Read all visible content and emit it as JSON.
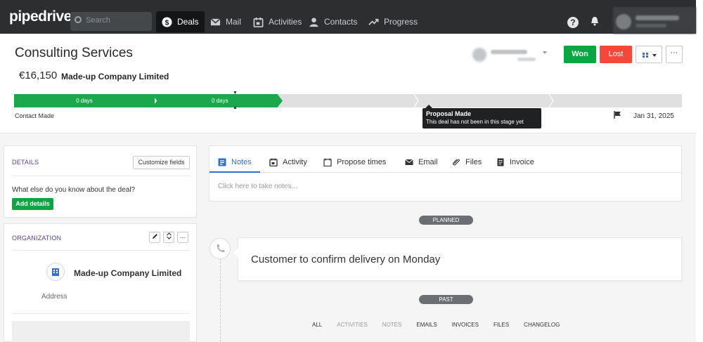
{
  "topbar": {
    "logo": "pipedrive",
    "search_placeholder": "Search",
    "nav": [
      {
        "label": "Deals",
        "icon": "dollar-circle-icon",
        "active": true
      },
      {
        "label": "Mail",
        "icon": "mail-icon"
      },
      {
        "label": "Activities",
        "icon": "calendar-icon"
      },
      {
        "label": "Contacts",
        "icon": "person-icon"
      },
      {
        "label": "Progress",
        "icon": "trend-icon"
      }
    ],
    "help_label": "?"
  },
  "deal": {
    "title": "Consulting Services",
    "value": "€16,150",
    "organization": "Made-up Company Limited",
    "won_label": "Won",
    "lost_label": "Lost",
    "more_label": "···"
  },
  "pipeline": {
    "stage1_label": "0 days",
    "stage2_label": "0 days",
    "current_stage": "Contact Made",
    "tooltip_title": "Proposal Made",
    "tooltip_text": "This deal has not been in this stage yet",
    "close_date": "Jan 31, 2025"
  },
  "details": {
    "title": "DETAILS",
    "customize_label": "Customize fields",
    "question": "What else do you know about the deal?",
    "add_label": "Add details"
  },
  "organization_card": {
    "title": "ORGANIZATION",
    "name": "Made-up Company Limited",
    "address_label": "Address",
    "more_label": "···"
  },
  "tabs": [
    {
      "label": "Notes",
      "active": true
    },
    {
      "label": "Activity"
    },
    {
      "label": "Propose times"
    },
    {
      "label": "Email"
    },
    {
      "label": "Files"
    },
    {
      "label": "Invoice"
    }
  ],
  "notes_placeholder": "Click here to take notes...",
  "timeline": {
    "planned_label": "PLANNED",
    "activity_text": "Customer to confirm delivery on Monday",
    "past_label": "PAST",
    "filters": [
      "ALL",
      "ACTIVITIES",
      "NOTES",
      "EMAILS",
      "INVOICES",
      "FILES",
      "CHANGELOG"
    ]
  },
  "colors": {
    "topbar": "#2c2e30",
    "green": "#08a742",
    "red": "#f5483a",
    "blue": "#2e6fd6",
    "section_title": "#5a3c8c"
  }
}
